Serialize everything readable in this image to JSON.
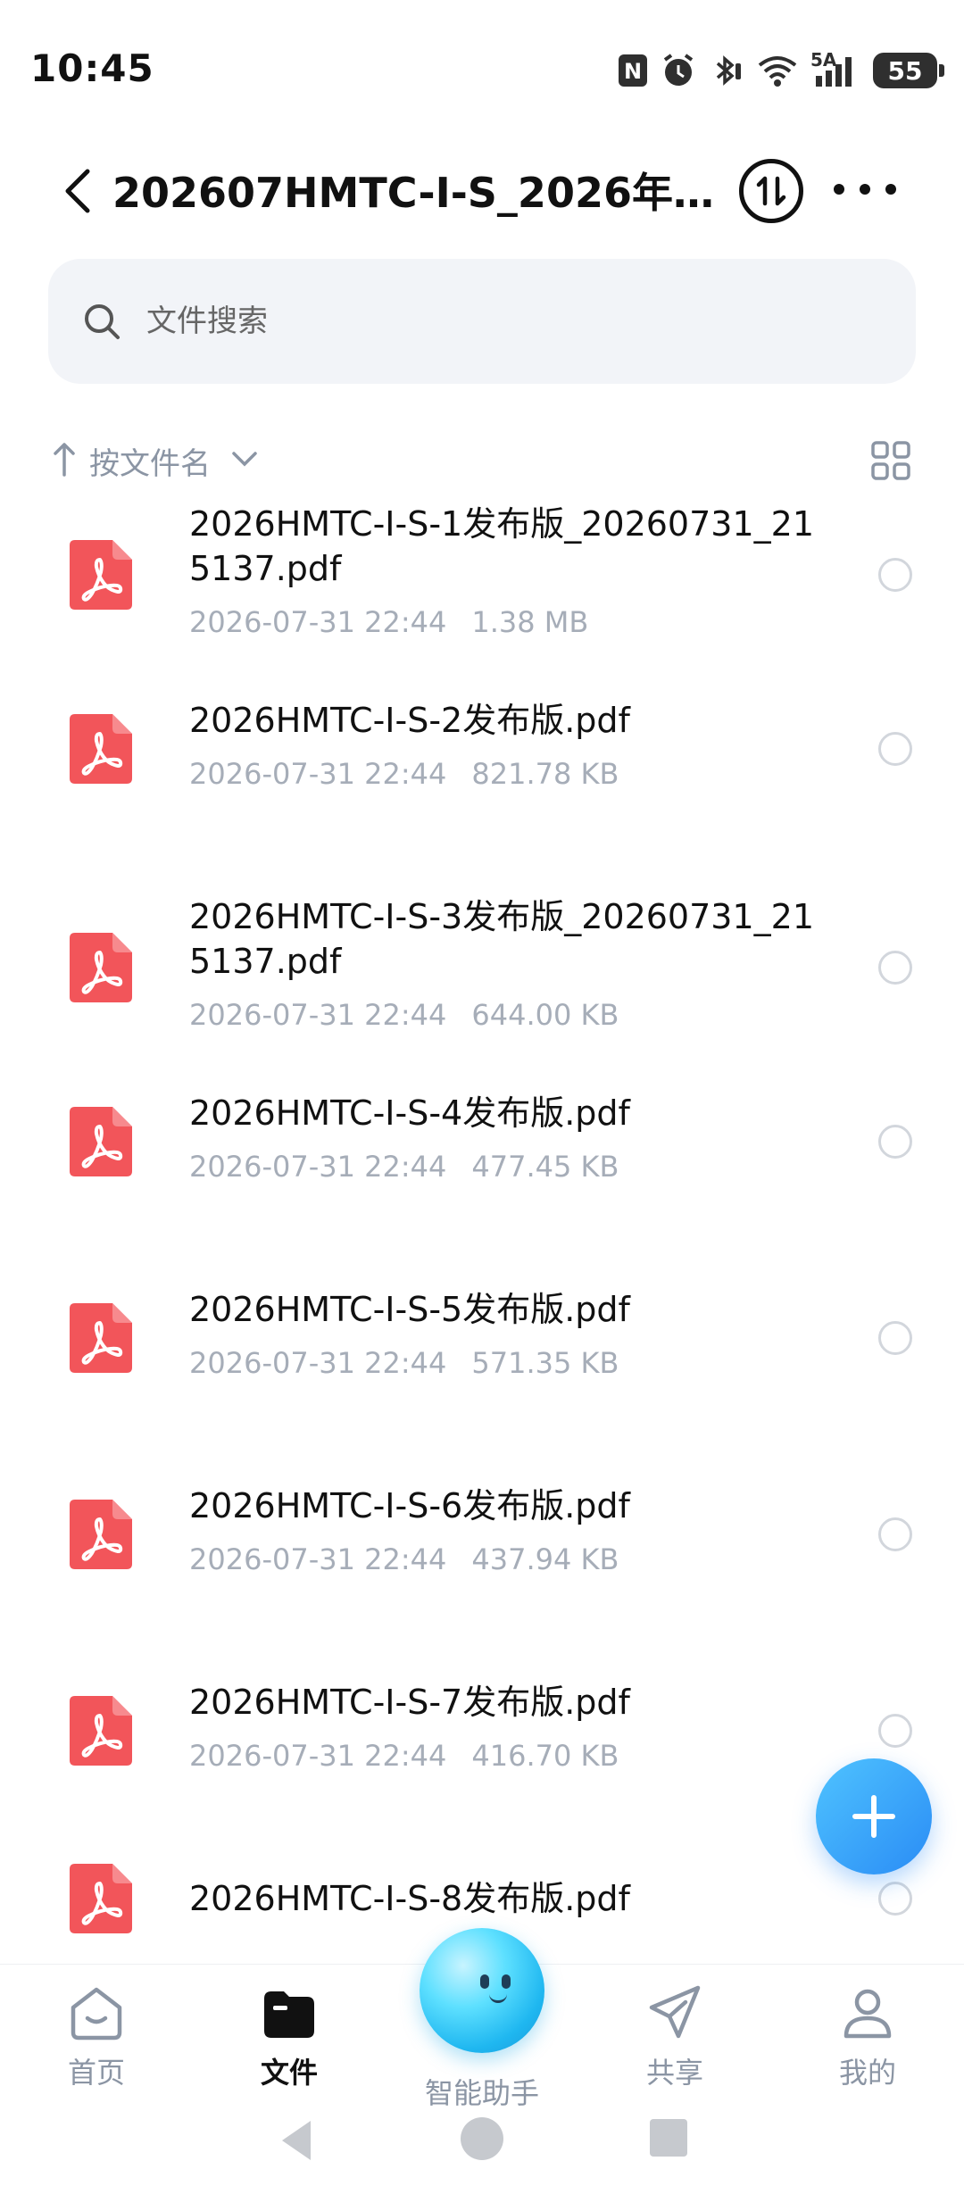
{
  "status_bar": {
    "time": "10:45",
    "network_label": "5A",
    "battery": "55",
    "icons": [
      "nfc-icon",
      "alarm-icon",
      "bluetooth-icon",
      "wifi-icon",
      "signal-icon",
      "battery-icon"
    ]
  },
  "header": {
    "title": "202607HMTC-I-S_2026年7月…"
  },
  "search": {
    "placeholder": "文件搜索"
  },
  "sort": {
    "label": "按文件名"
  },
  "files": [
    {
      "name": "2026HMTC-I-S-1发布版_20260731_215137.pdf",
      "date": "2026-07-31 22:44",
      "size": "1.38 MB"
    },
    {
      "name": "2026HMTC-I-S-2发布版.pdf",
      "date": "2026-07-31 22:44",
      "size": "821.78 KB"
    },
    {
      "name": "2026HMTC-I-S-3发布版_20260731_215137.pdf",
      "date": "2026-07-31 22:44",
      "size": "644.00 KB"
    },
    {
      "name": "2026HMTC-I-S-4发布版.pdf",
      "date": "2026-07-31 22:44",
      "size": "477.45 KB"
    },
    {
      "name": "2026HMTC-I-S-5发布版.pdf",
      "date": "2026-07-31 22:44",
      "size": "571.35 KB"
    },
    {
      "name": "2026HMTC-I-S-6发布版.pdf",
      "date": "2026-07-31 22:44",
      "size": "437.94 KB"
    },
    {
      "name": "2026HMTC-I-S-7发布版.pdf",
      "date": "2026-07-31 22:44",
      "size": "416.70 KB"
    },
    {
      "name": "2026HMTC-I-S-8发布版.pdf",
      "date": "",
      "size": ""
    }
  ],
  "bottom_nav": {
    "home": "首页",
    "files": "文件",
    "assistant": "智能助手",
    "share": "共享",
    "mine": "我的"
  },
  "colors": {
    "pdf_red": "#f2555a",
    "fab_blue": "#2a8cf5",
    "muted_text": "#8b95a4"
  }
}
